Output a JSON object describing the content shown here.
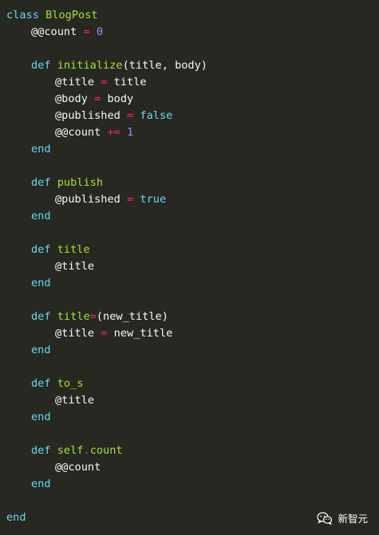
{
  "code": {
    "lines": {
      "l1": {
        "kw": "class",
        "name": "BlogPost"
      },
      "l2": {
        "ivar": "@@count",
        "op": "=",
        "num": "0"
      },
      "l4": {
        "kw": "def",
        "name": "initialize",
        "args": "(title, body)"
      },
      "l5": {
        "ivar": "@title",
        "op": "=",
        "val": "title"
      },
      "l6": {
        "ivar": "@body",
        "op": "=",
        "val": "body"
      },
      "l7": {
        "ivar": "@published",
        "op": "=",
        "val": "false"
      },
      "l8": {
        "ivar": "@@count",
        "op": "+=",
        "num": "1"
      },
      "l9": {
        "kw": "end"
      },
      "l11": {
        "kw": "def",
        "name": "publish"
      },
      "l12": {
        "ivar": "@published",
        "op": "=",
        "val": "true"
      },
      "l13": {
        "kw": "end"
      },
      "l15": {
        "kw": "def",
        "name": "title"
      },
      "l16": {
        "ivar": "@title"
      },
      "l17": {
        "kw": "end"
      },
      "l19": {
        "kw": "def",
        "name": "title",
        "op": "=",
        "args": "(new_title)"
      },
      "l20": {
        "ivar": "@title",
        "op": "=",
        "val": "new_title"
      },
      "l21": {
        "kw": "end"
      },
      "l23": {
        "kw": "def",
        "name": "to_s"
      },
      "l24": {
        "ivar": "@title"
      },
      "l25": {
        "kw": "end"
      },
      "l27": {
        "kw": "def",
        "name_a": "self",
        "dot": ".",
        "name_b": "count"
      },
      "l28": {
        "ivar": "@@count"
      },
      "l29": {
        "kw": "end"
      },
      "l31": {
        "kw": "end"
      }
    }
  },
  "watermark": {
    "text": "新智元",
    "icon": "wechat-icon"
  },
  "colors": {
    "background": "#272822",
    "keyword": "#66d9ef",
    "function": "#a6e22e",
    "operator": "#f92672",
    "number": "#ae81ff",
    "text": "#f8f8f2"
  }
}
